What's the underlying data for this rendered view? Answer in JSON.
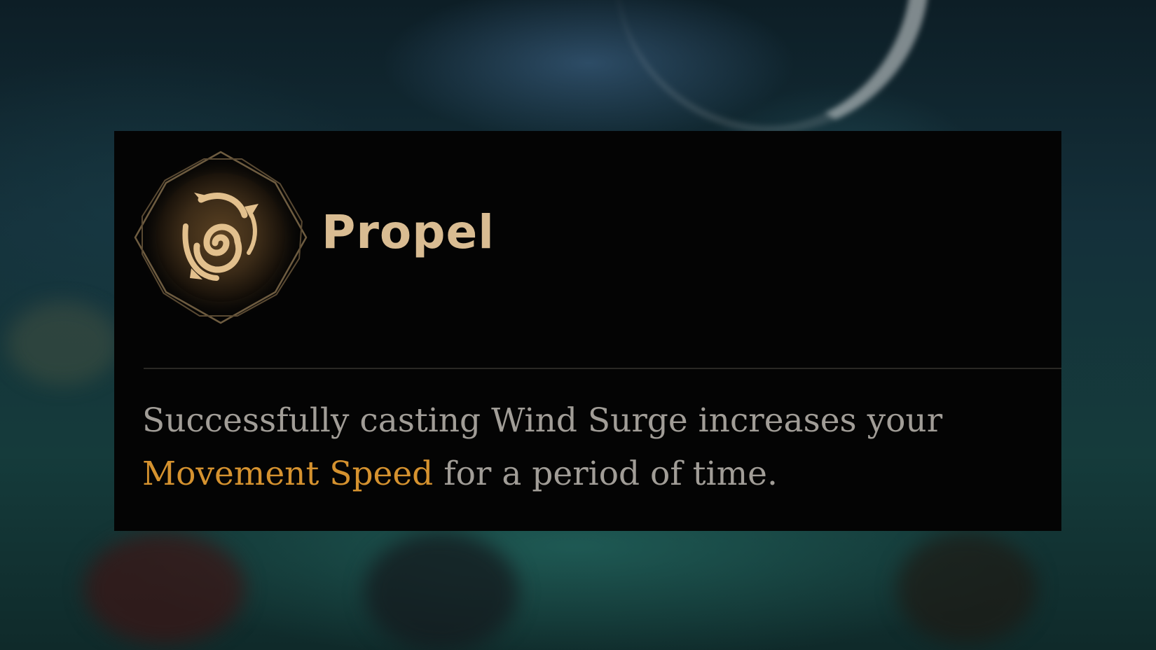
{
  "tooltip": {
    "title": "Propel",
    "description_before": "Successfully casting Wind Surge increases your",
    "description_highlight": "Movement Speed",
    "description_after": "for a period of time.",
    "icon": "wind-swirl-icon"
  },
  "colors": {
    "panel_bg": "#040404",
    "title": "#d9bc92",
    "body_text": "#a19d97",
    "highlight": "#d5922f",
    "icon_gold": "#e2c08d",
    "icon_frame": "#6e5c40"
  }
}
